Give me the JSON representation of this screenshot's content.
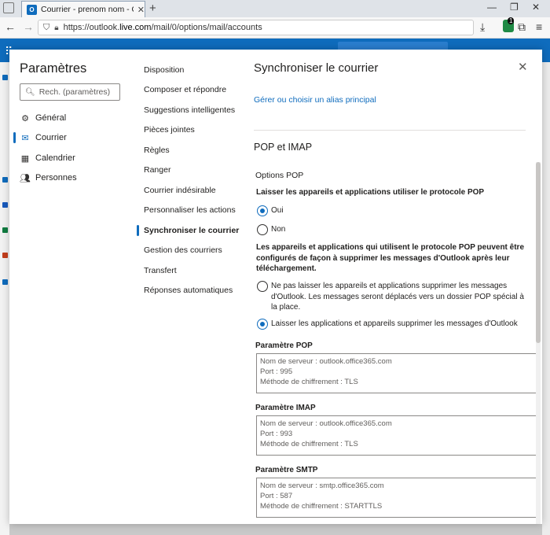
{
  "browser": {
    "tab_title": "Courrier - prenom nom - Outlo",
    "tab_close": "✕",
    "new_tab": "+",
    "url_prefix": "https://outlook.",
    "url_domain": "live.com",
    "url_path": "/mail/0/options/mail/accounts",
    "extension_count": "1"
  },
  "settings": {
    "title": "Paramètres",
    "search_placeholder": "Rech. (paramètres)",
    "categories": [
      {
        "label": "Général",
        "icon": "gear-icon"
      },
      {
        "label": "Courrier",
        "icon": "mail-icon"
      },
      {
        "label": "Calendrier",
        "icon": "calendar-icon"
      },
      {
        "label": "Personnes",
        "icon": "people-icon"
      }
    ],
    "active_category": "Courrier"
  },
  "mail_sections": [
    "Disposition",
    "Composer et répondre",
    "Suggestions intelligentes",
    "Pièces jointes",
    "Règles",
    "Ranger",
    "Courrier indésirable",
    "Personnaliser les actions",
    "Synchroniser le courrier",
    "Gestion des courriers",
    "Transfert",
    "Réponses automatiques"
  ],
  "active_section": "Synchroniser le courrier",
  "sync": {
    "title": "Synchroniser le courrier",
    "close": "✕",
    "alias_link": "Gérer ou choisir un alias principal",
    "section_title": "POP et IMAP",
    "pop_options_title": "Options POP",
    "pop_question": "Laisser les appareils et applications utiliser le protocole POP",
    "pop_yes": "Oui",
    "pop_no": "Non",
    "pop_yes_checked": true,
    "delete_question": "Les appareils et applications qui utilisent le protocole POP peuvent être configurés de façon à supprimer les messages d'Outlook après leur téléchargement.",
    "delete_option_1": "Ne pas laisser les appareils et applications supprimer les messages d'Outlook. Les messages seront déplacés vers un dossier POP spécial à la place.",
    "delete_option_2": "Laisser les applications et appareils supprimer les messages d'Outlook",
    "delete_option_2_checked": true,
    "pop_param": {
      "label": "Paramètre POP",
      "server": "Nom de serveur : outlook.office365.com",
      "port": "Port : 995",
      "encryption": "Méthode de chiffrement : TLS"
    },
    "imap_param": {
      "label": "Paramètre IMAP",
      "server": "Nom de serveur : outlook.office365.com",
      "port": "Port : 993",
      "encryption": "Méthode de chiffrement : TLS"
    },
    "smtp_param": {
      "label": "Paramètre SMTP",
      "server": "Nom de serveur : smtp.office365.com",
      "port": "Port : 587",
      "encryption": "Méthode de chiffrement : STARTTLS"
    }
  },
  "colors": {
    "accent": "#0f6cbd",
    "text": "#201f1e",
    "muted_text": "#605e5c",
    "border": "#8a8886"
  }
}
